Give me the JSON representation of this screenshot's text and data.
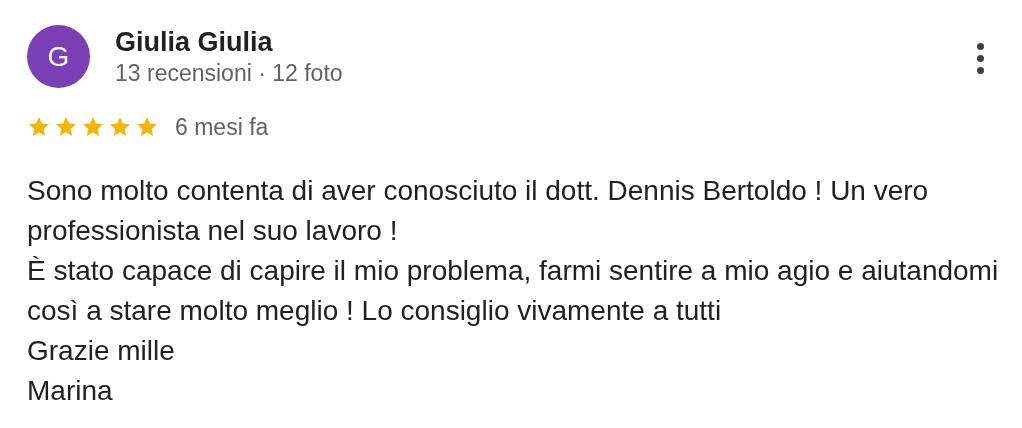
{
  "review": {
    "avatar_letter": "G",
    "name": "Giulia Giulia",
    "stats": "13 recensioni · 12 foto",
    "stars": 5,
    "time": "6 mesi fa",
    "paragraphs": [
      "Sono molto contenta di aver conosciuto il dott. Dennis Bertoldo ! Un vero professionista nel suo lavoro !",
      "È stato capace di capire il mio problema, farmi sentire a mio agio e aiutandomi così a stare molto meglio ! Lo consiglio vivamente a tutti",
      "Grazie mille",
      "Marina"
    ]
  }
}
